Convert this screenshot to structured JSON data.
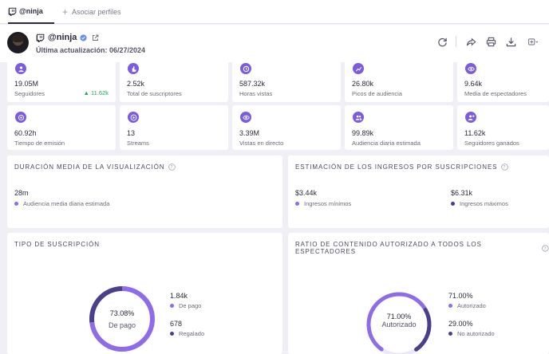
{
  "tabs": {
    "active_label": "@ninja",
    "add_label": "Asociar perfiles"
  },
  "header": {
    "name": "@ninja",
    "updated": "Última actualización: 06/27/2024"
  },
  "stats_row1": [
    {
      "icon": "users-icon",
      "value": "19.05M",
      "label": "Seguidores",
      "delta": "▲ 11.62k"
    },
    {
      "icon": "hand-icon",
      "value": "2.52k",
      "label": "Total de suscriptores"
    },
    {
      "icon": "clock-icon",
      "value": "587.32k",
      "label": "Horas vistas"
    },
    {
      "icon": "chart-icon",
      "value": "26.80k",
      "label": "Picos de audiencia"
    },
    {
      "icon": "eye-icon",
      "value": "9.64k",
      "label": "Media de espectadores"
    }
  ],
  "stats_row2": [
    {
      "icon": "broadcast-icon",
      "value": "60.92h",
      "label": "Tiempo de emisión"
    },
    {
      "icon": "play-icon",
      "value": "13",
      "label": "Streams"
    },
    {
      "icon": "eye-icon",
      "value": "3.39M",
      "label": "Vistas en directo"
    },
    {
      "icon": "group-icon",
      "value": "99.89k",
      "label": "Audiencia diaria estimada"
    },
    {
      "icon": "add-user-icon",
      "value": "11.62k",
      "label": "Seguidores ganados"
    }
  ],
  "panels": {
    "avg_view": {
      "title": "DURACIÓN MEDIA DE LA VISUALIZACIÓN",
      "value": "28m",
      "label": "Audiencia media diaria estimada"
    },
    "revenue": {
      "title": "ESTIMACIÓN DE LOS INGRESOS POR SUSCRIPCIONES",
      "min_value": "$3.44k",
      "min_label": "Ingresos mínimos",
      "max_value": "$6.31k",
      "max_label": "Ingresos máximos"
    },
    "sub_type": {
      "title": "TIPO DE SUSCRIPCIÓN",
      "center_value": "73.08%",
      "center_label": "De pago",
      "paid_value": "1.84k",
      "paid_label": "De pago",
      "gifted_value": "678",
      "gifted_label": "Regalado",
      "paid_fraction": 0.7308
    },
    "authorized": {
      "title": "RATIO DE CONTENIDO AUTORIZADO A TODOS LOS ESPECTADORES",
      "center_value": "71.00%",
      "center_label": "Autorizado",
      "auth_value": "71.00%",
      "auth_label": "Autorizado",
      "unauth_value": "29.00%",
      "unauth_label": "No autorizado",
      "auth_fraction": 0.71
    }
  },
  "colors": {
    "accent": "#7b5ce0",
    "accent_dark": "#4a3f8a",
    "positive": "#22a55a"
  }
}
